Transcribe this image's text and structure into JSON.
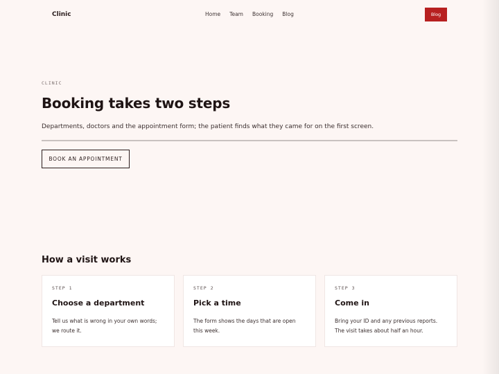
{
  "header": {
    "brand": "Clinic",
    "nav": [
      "Home",
      "Team",
      "Booking",
      "Blog"
    ],
    "cta_label": "Blog"
  },
  "hero": {
    "eyebrow": "CLINIC",
    "title": "Booking takes two steps",
    "subtitle": "Departments, doctors and the appointment form; the patient finds what they came for on the first screen.",
    "button_label": "BOOK AN APPOINTMENT"
  },
  "how": {
    "title": "How a visit works",
    "steps": [
      {
        "label": "STEP 1",
        "title": "Choose a department",
        "text": "Tell us what is wrong in your own words; we route it."
      },
      {
        "label": "STEP 2",
        "title": "Pick a time",
        "text": "The form shows the days that are open this week."
      },
      {
        "label": "STEP 3",
        "title": "Come in",
        "text": "Bring your ID and any previous reports. The visit takes about half an hour."
      }
    ]
  },
  "colors": {
    "background": "#fdf6f4",
    "accent": "#b72020",
    "text": "#1f1414"
  }
}
